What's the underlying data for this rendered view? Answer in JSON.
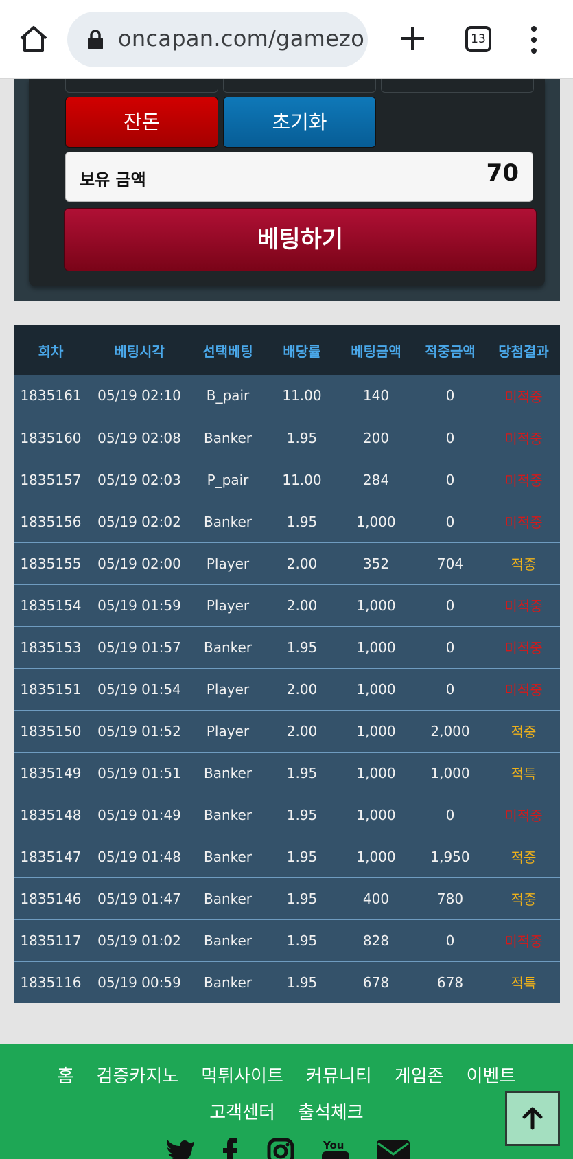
{
  "browser": {
    "url": "oncapan.com/gamezo",
    "tab_count": "13"
  },
  "panel": {
    "balance_button": "잔돈",
    "reset_button": "초기화",
    "holdings_label": "보유 금액",
    "holdings_value": "70",
    "bet_button": "베팅하기"
  },
  "table": {
    "headers": [
      "회차",
      "베팅시각",
      "선택베팅",
      "배당률",
      "베팅금액",
      "적중금액",
      "당첨결과"
    ],
    "rows": [
      [
        "1835161",
        "05/19 02:10",
        "B_pair",
        "11.00",
        "140",
        "0",
        "미적중"
      ],
      [
        "1835160",
        "05/19 02:08",
        "Banker",
        "1.95",
        "200",
        "0",
        "미적중"
      ],
      [
        "1835157",
        "05/19 02:03",
        "P_pair",
        "11.00",
        "284",
        "0",
        "미적중"
      ],
      [
        "1835156",
        "05/19 02:02",
        "Banker",
        "1.95",
        "1,000",
        "0",
        "미적중"
      ],
      [
        "1835155",
        "05/19 02:00",
        "Player",
        "2.00",
        "352",
        "704",
        "적중"
      ],
      [
        "1835154",
        "05/19 01:59",
        "Player",
        "2.00",
        "1,000",
        "0",
        "미적중"
      ],
      [
        "1835153",
        "05/19 01:57",
        "Banker",
        "1.95",
        "1,000",
        "0",
        "미적중"
      ],
      [
        "1835151",
        "05/19 01:54",
        "Player",
        "2.00",
        "1,000",
        "0",
        "미적중"
      ],
      [
        "1835150",
        "05/19 01:52",
        "Player",
        "2.00",
        "1,000",
        "2,000",
        "적중"
      ],
      [
        "1835149",
        "05/19 01:51",
        "Banker",
        "1.95",
        "1,000",
        "1,000",
        "적특"
      ],
      [
        "1835148",
        "05/19 01:49",
        "Banker",
        "1.95",
        "1,000",
        "0",
        "미적중"
      ],
      [
        "1835147",
        "05/19 01:48",
        "Banker",
        "1.95",
        "1,000",
        "1,950",
        "적중"
      ],
      [
        "1835146",
        "05/19 01:47",
        "Banker",
        "1.95",
        "400",
        "780",
        "적중"
      ],
      [
        "1835117",
        "05/19 01:02",
        "Banker",
        "1.95",
        "828",
        "0",
        "미적중"
      ],
      [
        "1835116",
        "05/19 00:59",
        "Banker",
        "1.95",
        "678",
        "678",
        "적특"
      ]
    ]
  },
  "footer": {
    "links": [
      "홈",
      "검증카지노",
      "먹튀사이트",
      "커뮤니티",
      "게임존",
      "이벤트",
      "고객센터",
      "출석체크"
    ],
    "social_icons": [
      "twitter-icon",
      "facebook-icon",
      "instagram-icon",
      "youtube-icon",
      "email-icon"
    ]
  },
  "colors": {
    "miss": "#d41a1a",
    "hit": "#f0b21a",
    "footer_bg": "#1ea755",
    "header_text": "#4aa8ea"
  }
}
